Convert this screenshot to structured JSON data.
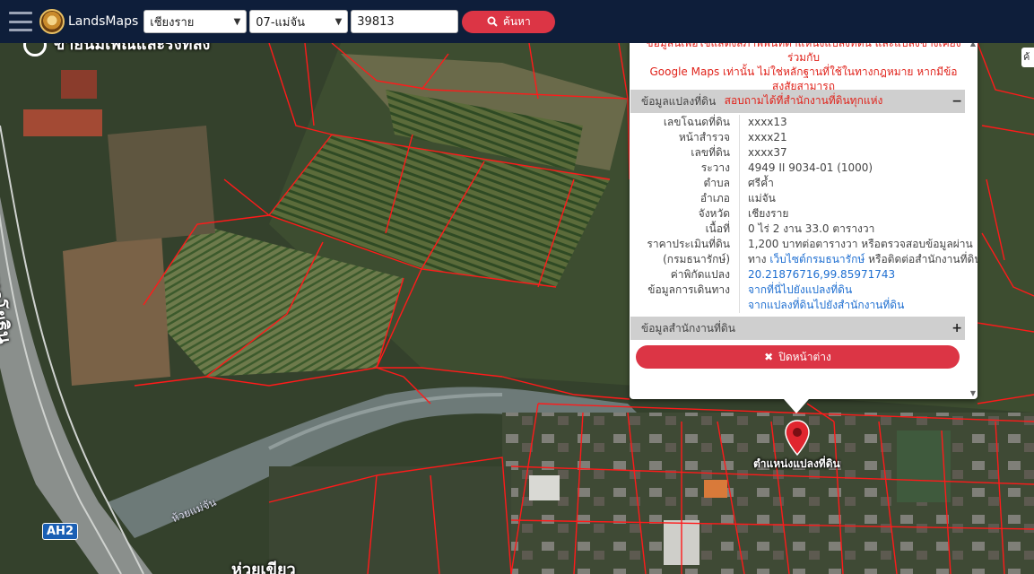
{
  "topbar": {
    "brand": "LandsMaps",
    "province": "เชียงราย",
    "district": "07-แม่จัน",
    "parcel_number": "39813",
    "search_label": "ค้นหา"
  },
  "map": {
    "road_label": "ถ. พหลโยธิน",
    "top_label": "ขายนมเพณีและรีงทลัง",
    "bottom_label": "ห่วยเขียว",
    "river_label": "ห้วยแม่จัน",
    "highway_shield": "AH2",
    "marker_label": "ตำแหน่งแปลงที่ดิน",
    "edge_button": "ค้"
  },
  "popup": {
    "disclaimer": [
      "ข้อมูลนี้เพื่อใช้แสดงสภาพพื้นที่ตำแหน่งแปลงที่ดิน และแปลงข้างเคียงร่วมกับ",
      "Google Maps เท่านั้น ไม่ใช่หลักฐานที่ใช้ในทางกฎหมาย หากมีข้อสงสัยสามารถ",
      "สอบถามได้ที่สำนักงานที่ดินทุกแห่ง"
    ],
    "parcel_section": {
      "title": "ข้อมูลแปลงที่ดิน",
      "toggle": "−",
      "rows": [
        {
          "k": "เลขโฉนดที่ดิน",
          "v": "xxxx13"
        },
        {
          "k": "หน้าสำรวจ",
          "v": "xxxx21"
        },
        {
          "k": "เลขที่ดิน",
          "v": "xxxx37"
        },
        {
          "k": "ระวาง",
          "v": "4949 II 9034-01 (1000)"
        },
        {
          "k": "ตำบล",
          "v": "ศรีค้ำ"
        },
        {
          "k": "อำเภอ",
          "v": "แม่จัน"
        },
        {
          "k": "จังหวัด",
          "v": "เชียงราย"
        },
        {
          "k": "เนื้อที่",
          "v": "0 ไร่ 2 งาน 33.0 ตารางวา"
        }
      ],
      "price": {
        "k1": "ราคาประเมินที่ดิน",
        "k2": "(กรมธนารักษ์)",
        "v1": "1,200 บาทต่อตารางวา หรือตรวจสอบข้อมูลผ่าน",
        "v2_pre": "ทาง",
        "v2_link": "เว็บไซต์กรมธนารักษ์",
        "v2_post": "หรือติดต่อสำนักงานที่ดิน"
      },
      "coord": {
        "k": "ค่าพิกัดแปลง",
        "v": "20.21876716,99.85971743"
      },
      "route": {
        "k": "ข้อมูลการเดินทาง",
        "link1": "จากที่นี่ไปยังแปลงที่ดิน",
        "link2": "จากแปลงที่ดินไปยังสำนักงานที่ดิน"
      }
    },
    "office_section": {
      "title": "ข้อมูลสำนักงานที่ดิน",
      "toggle": "+"
    },
    "close_label": "ปิดหน้าต่าง"
  },
  "colors": {
    "navbar": "#0e1e3a",
    "danger": "#dc3545",
    "parcel_line": "#ff1a1a",
    "link": "#1f6fd1"
  }
}
